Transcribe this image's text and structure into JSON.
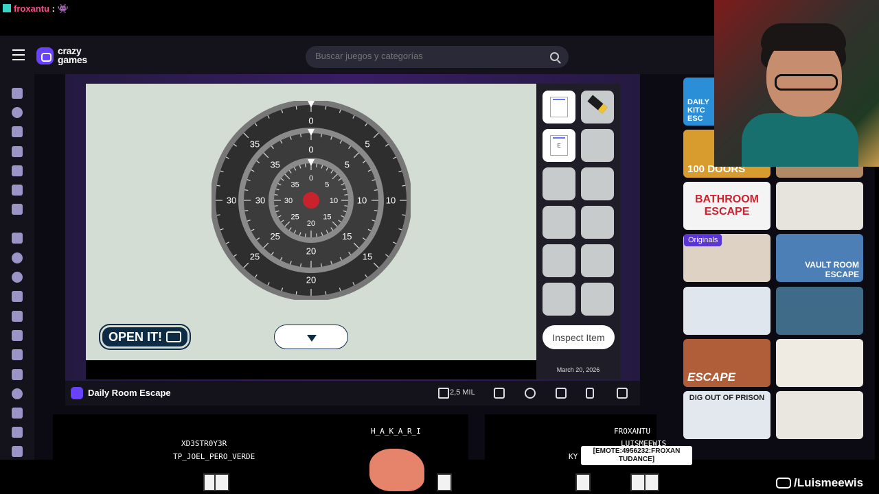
{
  "stream": {
    "chat_user": "froxantu",
    "chat_message": ": 👾",
    "youtube_handle": "/Luismeewis",
    "chatters": [
      "XD3STR0Y3R",
      "TP_JOEL_PERO_VERDE",
      "H_A_K_A_R_I",
      "FROXANTU",
      "LUISMEEWIS",
      "KY"
    ],
    "emote_tooltip_line1": "[EMOTE:4956232:FROXAN",
    "emote_tooltip_line2": "TUDANCE]"
  },
  "site": {
    "logo_line1": "crazy",
    "logo_line2": "games",
    "search_placeholder": "Buscar juegos y categorías"
  },
  "game": {
    "title": "Daily Room Escape",
    "likes": "2,5 MIL",
    "open_button": "OPEN IT!",
    "inspect_button": "Inspect Item",
    "date": "March 20, 2026",
    "note_mark": "E",
    "dial_outer": [
      "0",
      "5",
      "10",
      "15",
      "20",
      "25",
      "30",
      "35"
    ],
    "dial_middle": [
      "0",
      "5",
      "10",
      "15",
      "20",
      "25",
      "30",
      "35"
    ],
    "dial_inner": [
      "0",
      "5",
      "10",
      "15",
      "20",
      "25",
      "30",
      "35"
    ]
  },
  "thumbnails": {
    "kitchen": "DAILY KITC ESC",
    "doors": "100 DOORS",
    "bathroom": "BATHROOM ESCAPE",
    "originals_badge": "Originals",
    "vault": "VAULT ROOM ESCAPE",
    "escape": "ESCAPE",
    "prison": "DIG OUT OF PRISON"
  },
  "colors": {
    "brand": "#6842ff",
    "game_bg": "#d3ddd4",
    "dial_dark": "#333333",
    "knob_red": "#c8232c"
  }
}
